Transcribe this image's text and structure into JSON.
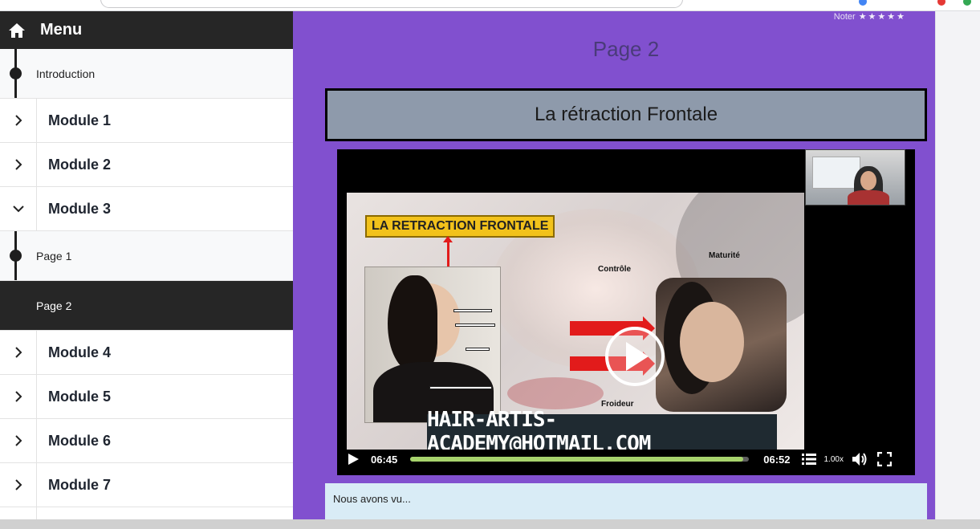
{
  "sidebar": {
    "header": {
      "icon": "home-icon",
      "title": "Menu"
    },
    "intro": {
      "label": "Introduction"
    },
    "modules_top": [
      {
        "label": "Module 1",
        "state": "collapsed"
      },
      {
        "label": "Module 2",
        "state": "collapsed"
      },
      {
        "label": "Module 3",
        "state": "expanded"
      }
    ],
    "pages": [
      {
        "label": "Page 1",
        "active": false
      },
      {
        "label": "Page 2",
        "active": true
      }
    ],
    "modules_bottom": [
      {
        "label": "Module 4",
        "state": "collapsed"
      },
      {
        "label": "Module 5",
        "state": "collapsed"
      },
      {
        "label": "Module 6",
        "state": "collapsed"
      },
      {
        "label": "Module 7",
        "state": "collapsed"
      }
    ]
  },
  "main": {
    "rating_label": "Noter",
    "rating_stars": "★★★★★",
    "page_heading": "Page 2",
    "lesson_title": "La rétraction Frontale",
    "video": {
      "slide_title": "LA RETRACTION FRONTALE",
      "label_controle": "Contrôle",
      "label_maturite": "Maturité",
      "label_froideur": "Froideur",
      "banner_email": "HAIR-ARTIS-ACADEMY@HOTMAIL.COM",
      "current_time": "06:45",
      "total_time": "06:52",
      "progress_fraction": 0.983,
      "speed": "1.00x"
    },
    "notes_text": "Nous avons vu..."
  },
  "colors": {
    "main_bg": "#8150cf",
    "sidebar_header_bg": "#262626",
    "title_box_bg": "#8e9aab",
    "progress_fill": "#a7d36c",
    "notes_bg": "#d9ecf6"
  }
}
